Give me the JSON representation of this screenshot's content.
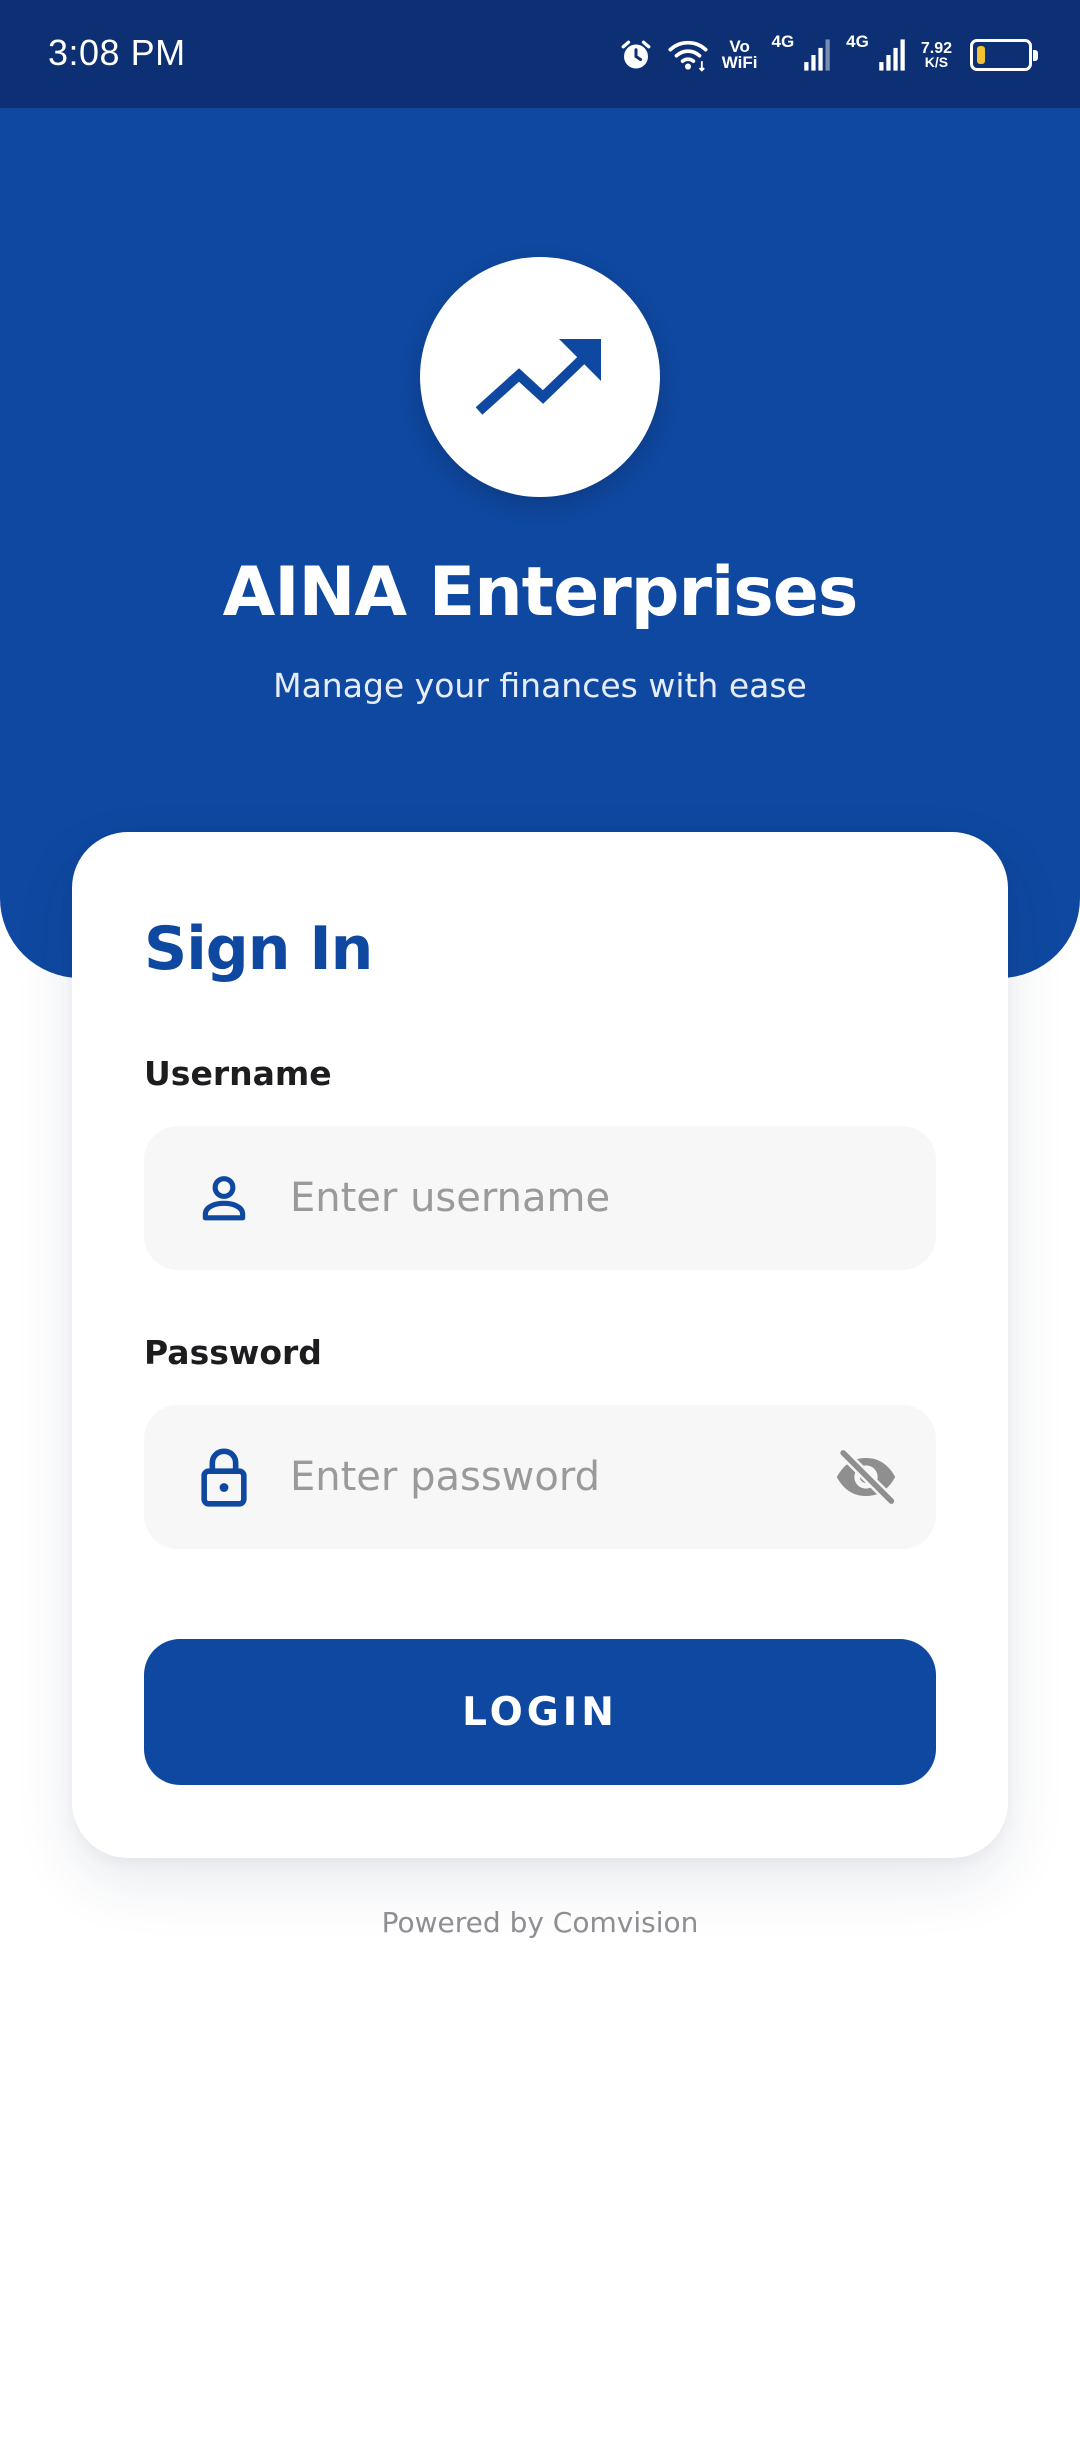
{
  "status_bar": {
    "time": "3:08 PM",
    "vowifi_top": "Vo",
    "vowifi_bottom": "WiFi",
    "network_1": "4G",
    "network_2": "4G",
    "speed_value": "7.92",
    "speed_unit": "K/S",
    "battery_level": 0.15,
    "icons": [
      "alarm-icon",
      "wifi-icon",
      "signal-icon",
      "battery-icon"
    ]
  },
  "header": {
    "logo_icon": "trending-up-icon",
    "title": "AINA Enterprises",
    "subtitle": "Manage your finances with ease"
  },
  "form": {
    "title": "Sign In",
    "username_label": "Username",
    "username_placeholder": "Enter username",
    "username_value": "",
    "username_icon": "person-icon",
    "password_label": "Password",
    "password_placeholder": "Enter password",
    "password_value": "",
    "password_icon": "lock-icon",
    "visibility_icon": "eye-off-icon",
    "login_label": "LOGIN"
  },
  "footer": {
    "text": "Powered by Comvision"
  },
  "colors": {
    "brand": "#0f48a0",
    "status_bar": "#0d2f73",
    "input_bg": "#f7f7f8",
    "battery": "#f2c230"
  }
}
